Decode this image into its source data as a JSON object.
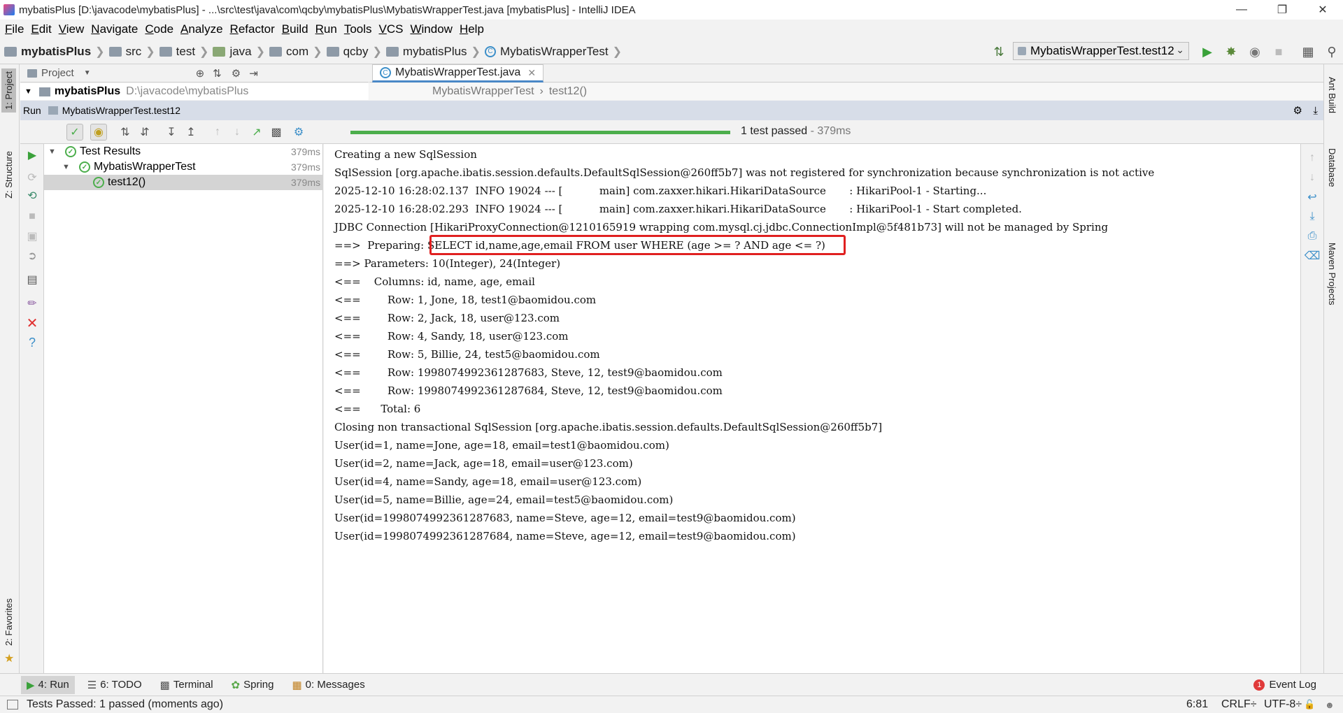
{
  "window": {
    "title": "mybatisPlus [D:\\javacode\\mybatisPlus] - ...\\src\\test\\java\\com\\qcby\\mybatisPlus\\MybatisWrapperTest.java [mybatisPlus] - IntelliJ IDEA"
  },
  "menu": [
    "File",
    "Edit",
    "View",
    "Navigate",
    "Code",
    "Analyze",
    "Refactor",
    "Build",
    "Run",
    "Tools",
    "VCS",
    "Window",
    "Help"
  ],
  "breadcrumbs": [
    "mybatisPlus",
    "src",
    "test",
    "java",
    "com",
    "qcby",
    "mybatisPlus",
    "MybatisWrapperTest"
  ],
  "run_config": "MybatisWrapperTest.test12",
  "project_panel": {
    "header": "Project",
    "root_name": "mybatisPlus",
    "root_path": "D:\\javacode\\mybatisPlus"
  },
  "left_tabs": [
    "1: Project",
    "Z: Structure",
    "2: Favorites"
  ],
  "right_tabs": [
    "Ant Build",
    "Database",
    "Maven Projects"
  ],
  "editor": {
    "tab": "MybatisWrapperTest.java",
    "crumb_class": "MybatisWrapperTest",
    "crumb_method": "test12()"
  },
  "run_panel": {
    "label": "Run",
    "config": "MybatisWrapperTest.test12",
    "status": "1 test passed",
    "time": " - 379ms"
  },
  "test_tree": [
    {
      "label": "Test Results",
      "time": "379ms"
    },
    {
      "label": "MybatisWrapperTest",
      "time": "379ms"
    },
    {
      "label": "test12()",
      "time": "379ms"
    }
  ],
  "console": [
    "Creating a new SqlSession",
    "SqlSession [org.apache.ibatis.session.defaults.DefaultSqlSession@260ff5b7] was not registered for synchronization because synchronization is not active",
    "2025-12-10 16:28:02.137  INFO 19024 --- [           main] com.zaxxer.hikari.HikariDataSource       : HikariPool-1 - Starting...",
    "2025-12-10 16:28:02.293  INFO 19024 --- [           main] com.zaxxer.hikari.HikariDataSource       : HikariPool-1 - Start completed.",
    "JDBC Connection [HikariProxyConnection@1210165919 wrapping com.mysql.cj.jdbc.ConnectionImpl@5f481b73] will not be managed by Spring",
    "==>  Preparing: SELECT id,name,age,email FROM user WHERE (age >= ? AND age <= ?)",
    "==> Parameters: 10(Integer), 24(Integer)",
    "<==    Columns: id, name, age, email",
    "<==        Row: 1, Jone, 18, test1@baomidou.com",
    "<==        Row: 2, Jack, 18, user@123.com",
    "<==        Row: 4, Sandy, 18, user@123.com",
    "<==        Row: 5, Billie, 24, test5@baomidou.com",
    "<==        Row: 1998074992361287683, Steve, 12, test9@baomidou.com",
    "<==        Row: 1998074992361287684, Steve, 12, test9@baomidou.com",
    "<==      Total: 6",
    "Closing non transactional SqlSession [org.apache.ibatis.session.defaults.DefaultSqlSession@260ff5b7]",
    "User(id=1, name=Jone, age=18, email=test1@baomidou.com)",
    "User(id=2, name=Jack, age=18, email=user@123.com)",
    "User(id=4, name=Sandy, age=18, email=user@123.com)",
    "User(id=5, name=Billie, age=24, email=test5@baomidou.com)",
    "User(id=1998074992361287683, name=Steve, age=12, email=test9@baomidou.com)",
    "User(id=1998074992361287684, name=Steve, age=12, email=test9@baomidou.com)"
  ],
  "bottom_tabs": [
    "4: Run",
    "6: TODO",
    "Terminal",
    "Spring",
    "0: Messages"
  ],
  "event_log": "Event Log",
  "event_count": "1",
  "status": {
    "message": "Tests Passed: 1 passed (moments ago)",
    "position": "6:81",
    "line_sep": "CRLF÷",
    "encoding": "UTF-8÷"
  },
  "colors": {
    "accent": "#4a88c7",
    "pass": "#4cae4c",
    "highlight": "#e02020"
  }
}
